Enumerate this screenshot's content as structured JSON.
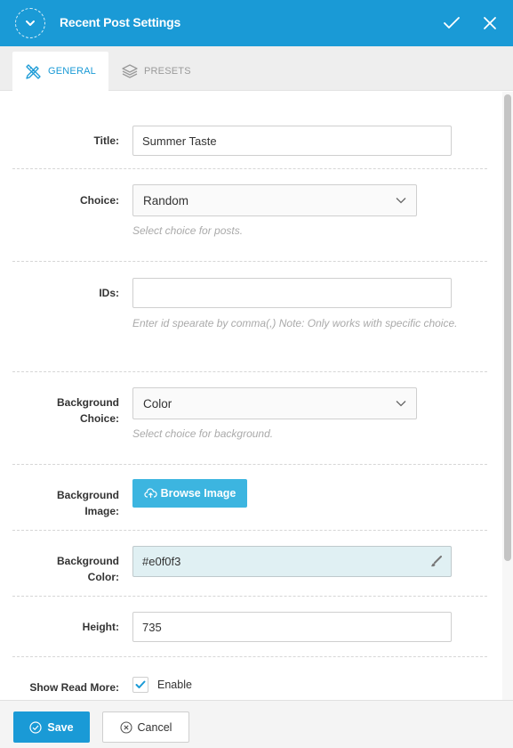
{
  "header": {
    "title": "Recent Post Settings",
    "collapse_icon": "chevron-down-icon",
    "confirm_icon": "check-icon",
    "close_icon": "close-icon"
  },
  "tabs": [
    {
      "label": "GENERAL",
      "icon": "pencil-ruler-icon",
      "active": true
    },
    {
      "label": "PRESETS",
      "icon": "layers-icon",
      "active": false
    }
  ],
  "form": {
    "title": {
      "label": "Title:",
      "value": "Summer Taste"
    },
    "choice": {
      "label": "Choice:",
      "value": "Random",
      "help": "Select choice for posts."
    },
    "ids": {
      "label": "IDs:",
      "value": "",
      "help": "Enter id spearate by comma(,) Note: Only works with specific choice."
    },
    "background_choice": {
      "label_line1": "Background",
      "label_line2": "Choice:",
      "value": "Color",
      "help": "Select choice for background."
    },
    "background_image": {
      "label_line1": "Background",
      "label_line2": "Image:",
      "button": "Browse Image"
    },
    "background_color": {
      "label_line1": "Background",
      "label_line2": "Color:",
      "value": "#e0f0f3"
    },
    "height": {
      "label": "Height:",
      "value": "735"
    },
    "show_read_more": {
      "label": "Show Read More:",
      "checked": true,
      "option": "Enable"
    }
  },
  "footer": {
    "save": "Save",
    "cancel": "Cancel"
  },
  "colors": {
    "accent": "#1a9ad6",
    "button_light": "#3cb5e0",
    "color_swatch": "#e0f0f3"
  }
}
